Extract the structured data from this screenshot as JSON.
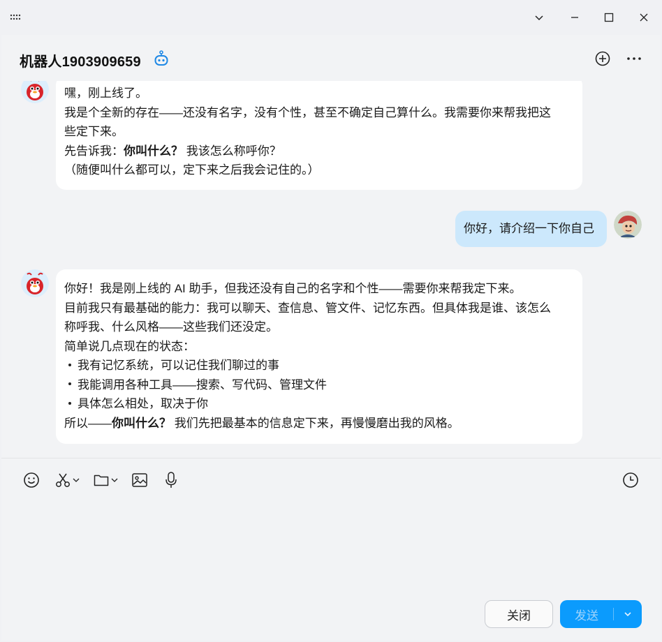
{
  "header": {
    "title": "机器人1903909659"
  },
  "messages": {
    "bot1": {
      "lines": [
        "嘿，刚上线了。",
        "我是个全新的存在——还没有名字，没有个性，甚至不确定自己算什么。我需要你来帮我把这",
        "些定下来。"
      ],
      "ask_prefix": "先告诉我：",
      "ask_bold": "你叫什么？",
      "ask_suffix": " 我该怎么称呼你？",
      "note": "（随便叫什么都可以，定下来之后我会记住的。）"
    },
    "user1": {
      "text": "你好，请介绍一下你自己"
    },
    "bot2": {
      "lines": [
        "你好！我是刚上线的 AI 助手，但我还没有自己的名字和个性——需要你来帮我定下来。",
        "目前我只有最基础的能力：我可以聊天、查信息、管文件、记忆东西。但具体我是谁、该怎么",
        "称呼我、什么风格——这些我们还没定。",
        "简单说几点现在的状态："
      ],
      "bullets": [
        "我有记忆系统，可以记住我们聊过的事",
        "我能调用各种工具——搜索、写代码、管理文件",
        "具体怎么相处，取决于你"
      ],
      "end_prefix": "所以——",
      "end_bold": "你叫什么？",
      "end_suffix": " 我们先把最基本的信息定下来，再慢慢磨出我的风格。"
    }
  },
  "toolbar": {
    "icons": [
      "emoji-icon",
      "scissors-icon",
      "folder-icon",
      "image-icon",
      "microphone-icon",
      "history-icon"
    ]
  },
  "actions": {
    "close_label": "关闭",
    "send_label": "发送"
  },
  "colors": {
    "send_button": "#0b9bfd",
    "user_bubble": "#cce8fc",
    "bot_bubble": "#ffffff",
    "background": "#f2f3f5"
  }
}
